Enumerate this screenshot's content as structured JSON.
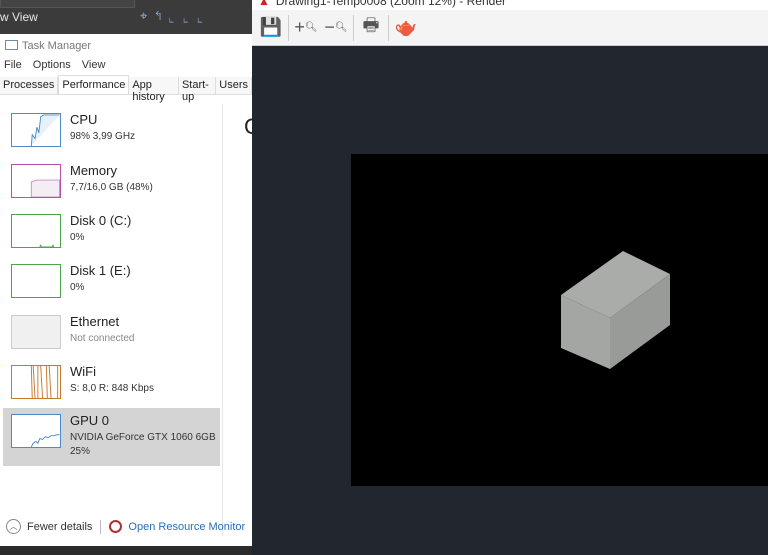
{
  "background_app": {
    "view_label": "w View"
  },
  "task_manager": {
    "title": "Task Manager",
    "menu": [
      "File",
      "Options",
      "View"
    ],
    "tabs": [
      "Processes",
      "Performance",
      "App history",
      "Start-up",
      "Users"
    ],
    "active_tab": "Performance",
    "items": [
      {
        "name": "CPU",
        "detail": "98% 3,99 GHz",
        "color": "#4a8cc7"
      },
      {
        "name": "Memory",
        "detail": "7,7/16,0 GB (48%)",
        "color": "#b84fb0"
      },
      {
        "name": "Disk 0 (C:)",
        "detail": "0%",
        "color": "#4aa84a"
      },
      {
        "name": "Disk 1 (E:)",
        "detail": "0%",
        "color": "#4aa84a"
      },
      {
        "name": "Ethernet",
        "detail": "Not connected",
        "color": "#bbbbbb"
      },
      {
        "name": "WiFi",
        "detail": "S: 8,0 R: 848 Kbps",
        "color": "#c8782a"
      },
      {
        "name": "GPU 0",
        "detail": "NVIDIA GeForce GTX 1060 6GB",
        "detail2": "25%",
        "color": "#4a8cc7",
        "selected": true
      }
    ],
    "fewer_details": "Fewer details",
    "resource_monitor": "Open Resource Monitor"
  },
  "render_window": {
    "title": "Drawing1-Temp0008 (Zoom 12%) - Render",
    "toolbar": [
      "save-icon",
      "zoom-in-icon",
      "zoom-out-icon",
      "print-icon",
      "teapot-icon"
    ],
    "background": "#22262e"
  }
}
